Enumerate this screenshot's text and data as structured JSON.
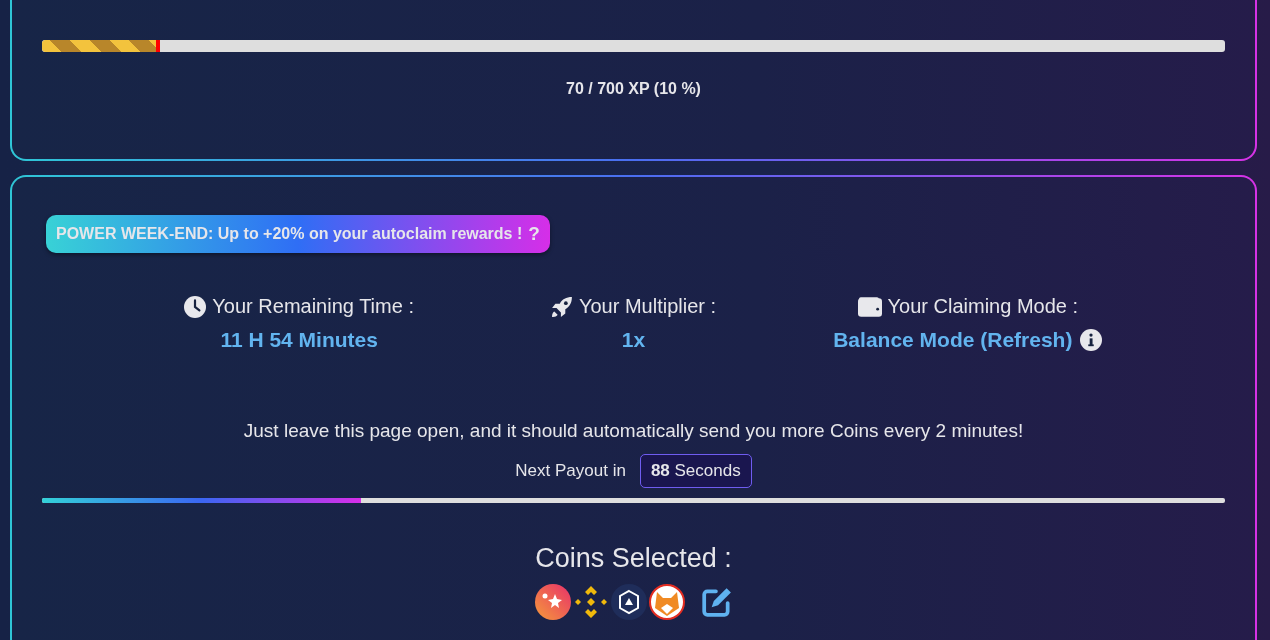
{
  "xp_card": {
    "progress": {
      "level": 0.1
    },
    "reading": "70 / 700 XP (10 %)"
  },
  "autoclaim_card": {
    "promo_badge": {
      "text": "POWER WEEK-END: Up to +20% on your autoclaim rewards !",
      "help": "?"
    },
    "stats": [
      {
        "kind": "time",
        "label": "Your Remaining Time :",
        "value": "11 H 54 Minutes",
        "info": false
      },
      {
        "kind": "multiplier",
        "label": "Your Multiplier :",
        "value": "1x",
        "info": false
      },
      {
        "kind": "mode",
        "label": "Your Claiming Mode :",
        "value": "Balance Mode (Refresh)",
        "info": true
      }
    ],
    "message": "Just leave this page open, and it should automatically send you more Coins every 2 minutes!",
    "next_payout": {
      "label": "Next Payout in",
      "count": "88",
      "unit": "Seconds"
    },
    "payout_progress": {
      "level": 0.27
    },
    "coins_heading": "Coins Selected :"
  }
}
